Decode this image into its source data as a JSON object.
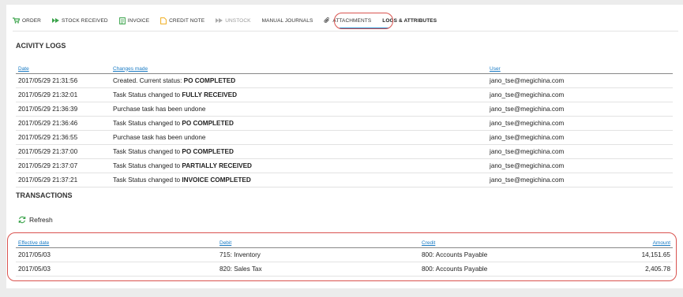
{
  "tabs": [
    {
      "label": "ORDER",
      "icon": "cart-icon",
      "state": "normal",
      "icon_color": "#3aa34a"
    },
    {
      "label": "STOCK RECEIVED",
      "icon": "truck-icon",
      "state": "normal",
      "icon_color": "#3aa34a"
    },
    {
      "label": "INVOICE",
      "icon": "invoice-icon",
      "state": "normal",
      "icon_color": "#3aa34a"
    },
    {
      "label": "CREDIT NOTE",
      "icon": "note-icon",
      "state": "normal",
      "icon_color": "#f0ad1e"
    },
    {
      "label": "UNSTOCK",
      "icon": "truck-icon",
      "state": "disabled",
      "icon_color": "#aaaaaa"
    },
    {
      "label": "MANUAL JOURNALS",
      "icon": "",
      "state": "normal"
    },
    {
      "label": "ATTACHMENTS",
      "icon": "paperclip-icon",
      "state": "normal"
    },
    {
      "label": "LOGS & ATTRIBUTES",
      "icon": "",
      "state": "active"
    }
  ],
  "activity": {
    "title": "ACIVITY LOGS",
    "columns": {
      "date": "Date",
      "changes": "Changes made",
      "user": "User"
    },
    "rows": [
      {
        "date": "2017/05/29 21:31:56",
        "text": "Created. Current status: ",
        "status": "PO COMPLETED",
        "user": "jano_tse@megichina.com"
      },
      {
        "date": "2017/05/29 21:32:01",
        "text": "Task Status changed to ",
        "status": "FULLY RECEIVED",
        "user": "jano_tse@megichina.com"
      },
      {
        "date": "2017/05/29 21:36:39",
        "text": "Purchase task has been undone",
        "status": "",
        "user": "jano_tse@megichina.com"
      },
      {
        "date": "2017/05/29 21:36:46",
        "text": "Task Status changed to ",
        "status": "PO COMPLETED",
        "user": "jano_tse@megichina.com"
      },
      {
        "date": "2017/05/29 21:36:55",
        "text": "Purchase task has been undone",
        "status": "",
        "user": "jano_tse@megichina.com"
      },
      {
        "date": "2017/05/29 21:37:00",
        "text": "Task Status changed to ",
        "status": "PO COMPLETED",
        "user": "jano_tse@megichina.com"
      },
      {
        "date": "2017/05/29 21:37:07",
        "text": "Task Status changed to ",
        "status": "PARTIALLY RECEIVED",
        "user": "jano_tse@megichina.com"
      },
      {
        "date": "2017/05/29 21:37:21",
        "text": "Task Status changed to ",
        "status": "INVOICE COMPLETED",
        "user": "jano_tse@megichina.com"
      }
    ]
  },
  "transactions": {
    "title": "TRANSACTIONS",
    "refresh_label": "Refresh",
    "columns": {
      "effective_date": "Effective date",
      "debit": "Debit",
      "credit": "Credit",
      "amount": "Amount"
    },
    "rows": [
      {
        "effective_date": "2017/05/03",
        "debit": "715: Inventory",
        "credit": "800: Accounts Payable",
        "amount": "14,151.65"
      },
      {
        "effective_date": "2017/05/03",
        "debit": "820: Sales Tax",
        "credit": "800: Accounts Payable",
        "amount": "2,405.78"
      }
    ]
  },
  "colors": {
    "accent": "#1a7bc4",
    "highlight": "#d9534f",
    "icon_green": "#3aa34a"
  }
}
